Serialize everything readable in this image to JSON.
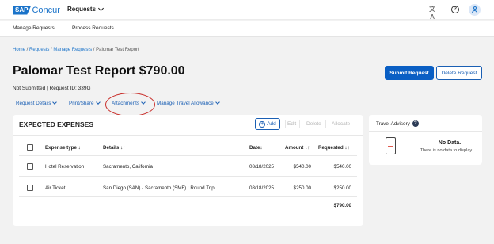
{
  "header": {
    "logo_sap": "SAP",
    "logo_concur": "Concur",
    "nav_menu": "Requests",
    "translate_icon_glyph": "文A"
  },
  "subnav": {
    "items": [
      "Manage Requests",
      "Process Requests"
    ]
  },
  "breadcrumb": {
    "home": "Home",
    "requests": "Requests",
    "manage_requests": "Manage Requests",
    "current": "Palomar Test Report",
    "separator": " / "
  },
  "report": {
    "title": "Palomar Test Report $790.00",
    "status": "Not Submitted",
    "request_id": "Request ID: 339G"
  },
  "buttons": {
    "submit": "Submit Request",
    "delete": "Delete Request"
  },
  "action_menus": [
    "Request Details",
    "Print/Share",
    "Attachments",
    "Manage Travel Allowance"
  ],
  "expenses": {
    "title": "EXPECTED EXPENSES",
    "add_label": "Add",
    "edit_label": "Edit",
    "delete_label": "Delete",
    "allocate_label": "Allocate",
    "columns": {
      "expense_type": "Expense type",
      "details": "Details",
      "date": "Date",
      "amount": "Amount",
      "requested": "Requested"
    },
    "rows": [
      {
        "expense_type": "Hotel Reservation",
        "details": "Sacramento, California",
        "date": "08/18/2025",
        "amount": "$540.00",
        "requested": "$540.00"
      },
      {
        "expense_type": "Air Ticket",
        "details": "San Diego (SAN) - Sacramento (SMF) : Round Trip",
        "date": "08/18/2025",
        "amount": "$250.00",
        "requested": "$250.00"
      }
    ],
    "total": "$790.00"
  },
  "advisory": {
    "title": "Travel Advisory",
    "no_data_title": "No Data.",
    "no_data_sub": "There is no data to display."
  },
  "colors": {
    "primary": "#0a5fc4",
    "link": "#1a5fb4",
    "highlight_ring": "#c9302c"
  }
}
